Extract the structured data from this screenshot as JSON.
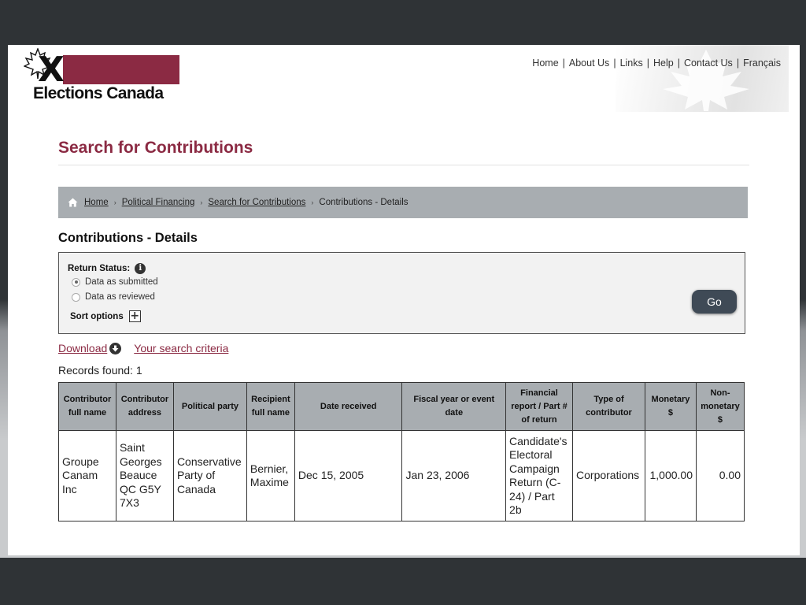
{
  "logo": {
    "text": "Elections Canada",
    "mark": "X"
  },
  "topnav": [
    "Home",
    "About Us",
    "Links",
    "Help",
    "Contact Us",
    "Français"
  ],
  "page_title": "Search for Contributions",
  "breadcrumb": {
    "items": [
      "Home",
      "Political Financing",
      "Search for Contributions"
    ],
    "current": "Contributions - Details"
  },
  "subtitle": "Contributions - Details",
  "options": {
    "return_status_label": "Return Status:",
    "radios": [
      {
        "label": "Data as submitted",
        "selected": true
      },
      {
        "label": "Data as reviewed",
        "selected": false
      }
    ],
    "sort_label": "Sort options",
    "go_label": "Go"
  },
  "links": {
    "download": "Download",
    "criteria": "Your search criteria"
  },
  "records_found": "Records found: 1",
  "table": {
    "headers": [
      "Contributor full name",
      "Contributor address",
      "Political party",
      "Recipient full name",
      "Date received",
      "Fiscal year or event date",
      "Financial report / Part # of return",
      "Type of contributor",
      "Monetary $",
      "Non-monetary $"
    ],
    "rows": [
      [
        "Groupe Canam Inc",
        "Saint Georges Beauce QC G5Y 7X3",
        "Conservative Party of Canada",
        "Bernier, Maxime",
        "Dec 15, 2005",
        "Jan 23, 2006",
        "Candidate's Electoral Campaign Return (C-24) / Part 2b",
        "Corporations",
        "1,000.00",
        "0.00"
      ]
    ]
  },
  "colors": {
    "brand": "#8b2a43",
    "breadcrumb_bg": "#a8adb1",
    "go_button": "#3f4a56"
  }
}
